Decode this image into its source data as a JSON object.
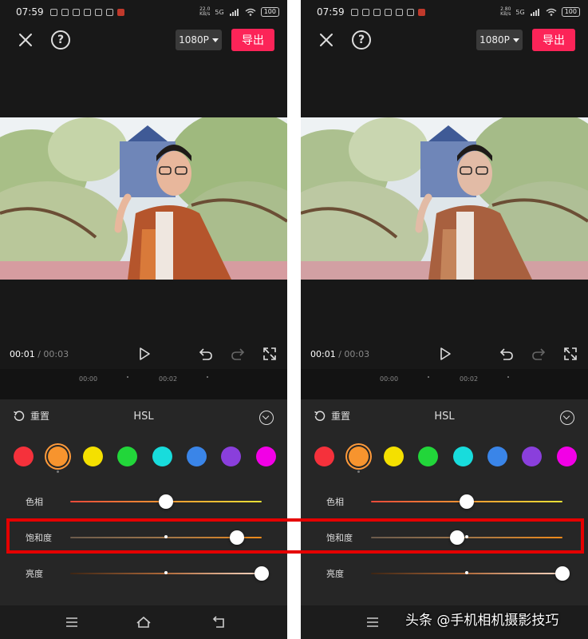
{
  "status": {
    "time": "07:59",
    "left_speed": "22.0",
    "right_speed": "2.80",
    "speed_unit": "KB/s",
    "network": "5G",
    "battery": "100"
  },
  "topbar": {
    "resolution": "1080P",
    "export_label": "导出"
  },
  "playback": {
    "current": "00:01",
    "separator": " / ",
    "duration": "00:03"
  },
  "timeline": {
    "tick_a": "00:00",
    "tick_b": "00:02"
  },
  "panel": {
    "reset_label": "重置",
    "title": "HSL"
  },
  "colors": {
    "swatches": [
      "#f5313b",
      "#f7942e",
      "#f4e000",
      "#22d63a",
      "#18dcdc",
      "#3a85e8",
      "#8a3fdc",
      "#f200e6"
    ],
    "selected_index": 1,
    "accent": "#fc2458",
    "highlight": "#e50000"
  },
  "sliders": {
    "hue": {
      "label": "色相",
      "left_value": 0.5,
      "right_value": 0.5
    },
    "saturation": {
      "label": "饱和度",
      "left_value": 0.87,
      "right_value": 0.45
    },
    "brightness": {
      "label": "亮度",
      "left_value": 1.0,
      "right_value": 1.0
    }
  },
  "watermark": "头条 @手机相机摄影技巧",
  "icons": {
    "close": "close-icon",
    "help": "help-icon",
    "play": "play-icon",
    "undo": "undo-icon",
    "redo": "redo-icon",
    "fullscreen": "fullscreen-icon",
    "reset": "reset-icon",
    "collapse": "chevron-down-icon",
    "menu": "menu-icon",
    "home": "home-icon",
    "back": "back-icon"
  }
}
